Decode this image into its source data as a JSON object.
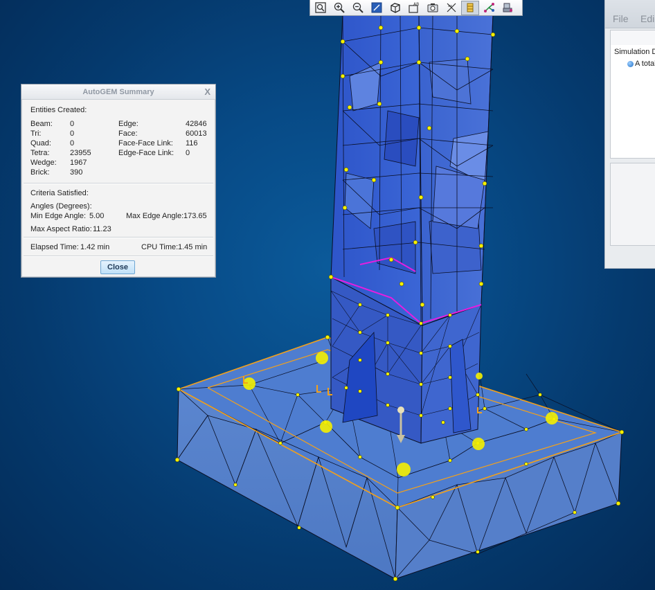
{
  "toolbar": {
    "buttons": [
      {
        "name": "refit-icon"
      },
      {
        "name": "zoom-in-icon"
      },
      {
        "name": "zoom-out-icon"
      },
      {
        "name": "repaint-icon"
      },
      {
        "name": "saved-views-icon"
      },
      {
        "name": "named-views-icon"
      },
      {
        "name": "snapshot-icon"
      },
      {
        "name": "datum-display-icon"
      },
      {
        "name": "mesh-display-icon"
      },
      {
        "name": "simulation-display-icon"
      },
      {
        "name": "annotation-display-icon"
      }
    ]
  },
  "side_panel": {
    "menu_file": "File",
    "menu_edit": "Edi",
    "simulation_title": "Simulation Di",
    "info_line": "A total"
  },
  "dialog": {
    "title": "AutoGEM Summary",
    "close_glyph": "X",
    "entities_header": "Entities Created:",
    "entities_left": [
      {
        "label": "Beam:",
        "value": "0"
      },
      {
        "label": "Tri:",
        "value": "0"
      },
      {
        "label": "Quad:",
        "value": "0"
      },
      {
        "label": "Tetra:",
        "value": "23955"
      },
      {
        "label": "Wedge:",
        "value": "1967"
      },
      {
        "label": "Brick:",
        "value": "390"
      }
    ],
    "entities_right": [
      {
        "label": "Edge:",
        "value": "42846"
      },
      {
        "label": "Face:",
        "value": "60013"
      },
      {
        "label": "Face-Face Link:",
        "value": "116"
      },
      {
        "label": "Edge-Face Link:",
        "value": "0"
      }
    ],
    "criteria_header": "Criteria Satisfied:",
    "angles_header": "Angles (Degrees):",
    "min_edge_label": "Min Edge Angle:",
    "min_edge_value": "5.00",
    "max_edge_label": "Max Edge Angle:",
    "max_edge_value": "173.65",
    "aspect_label": "Max Aspect Ratio:",
    "aspect_value": "11.23",
    "elapsed_label": "Elapsed Time:",
    "elapsed_value": "1.42 min",
    "cpu_label": "CPU Time:",
    "cpu_value": "1.45 min",
    "close_button": "Close"
  },
  "colors": {
    "background": "#053a6e",
    "mesh_surface": "#3f6fd0",
    "mesh_lines": "#0a0f24",
    "nodes": "#f5f000",
    "constraints": "#f4a11a",
    "boundary": "#e51ee0"
  }
}
